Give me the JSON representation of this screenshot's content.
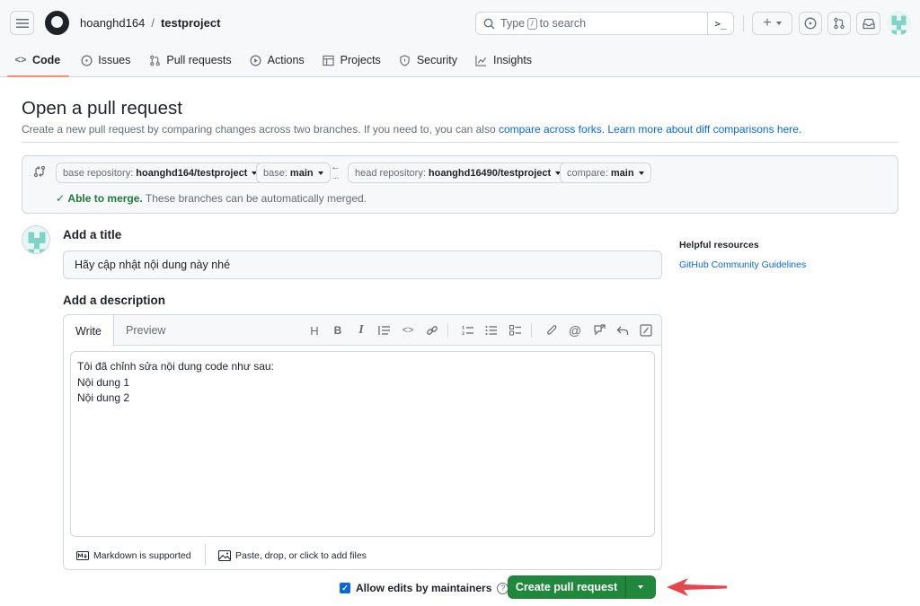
{
  "header": {
    "owner": "hoanghd164",
    "separator": "/",
    "repo": "testproject",
    "search": {
      "prefix": "Type",
      "key": "/",
      "suffix": "to search",
      "command_icon": "command-palette-icon"
    },
    "actions": [
      "plus-icon",
      "issue-opened-icon",
      "git-pull-request-icon",
      "inbox-icon"
    ]
  },
  "tabs": [
    {
      "label": "Code",
      "icon": "code-icon",
      "active": true
    },
    {
      "label": "Issues",
      "icon": "issue-opened-icon"
    },
    {
      "label": "Pull requests",
      "icon": "git-pull-request-icon"
    },
    {
      "label": "Actions",
      "icon": "play-icon"
    },
    {
      "label": "Projects",
      "icon": "table-icon"
    },
    {
      "label": "Security",
      "icon": "shield-icon"
    },
    {
      "label": "Insights",
      "icon": "graph-icon"
    }
  ],
  "page": {
    "title": "Open a pull request",
    "subtitle": "Create a new pull request by comparing changes across two branches. If you need to, you can also ",
    "link_compare_forks": "compare across forks.",
    "link_learn_more": "Learn more about diff comparisons here."
  },
  "compare": {
    "base_repo_label": "base repository:",
    "base_repo_value": "hoanghd164/testproject",
    "base_label": "base:",
    "base_value": "main",
    "arrow": "←",
    "dots": "...",
    "head_repo_label": "head repository:",
    "head_repo_value": "hoanghd16490/testproject",
    "compare_label": "compare:",
    "compare_value": "main",
    "merge_status": "Able to merge.",
    "merge_detail": " These branches can be automatically merged."
  },
  "form": {
    "title_label": "Add a title",
    "title_value": "Hãy cập nhật nội dung này nhé",
    "description_label": "Add a description",
    "tab_write": "Write",
    "tab_preview": "Preview",
    "body": "Tôi đã chỉnh sửa nội dung code như sau:\nNội dung 1\nNội dung 2",
    "markdown_note": "Markdown is supported",
    "attach_note": "Paste, drop, or click to add files",
    "allow_edits": "Allow edits by maintainers",
    "allow_edits_checked": true,
    "submit": "Create pull request"
  },
  "sidebar": {
    "heading": "Helpful resources",
    "link": "GitHub Community Guidelines"
  },
  "colors": {
    "primary_button": "#1f883d",
    "link": "#0969da",
    "success": "#1a7f37",
    "active_tab_underline": "#fd8c73",
    "annotation_arrow": "#e5474b"
  }
}
